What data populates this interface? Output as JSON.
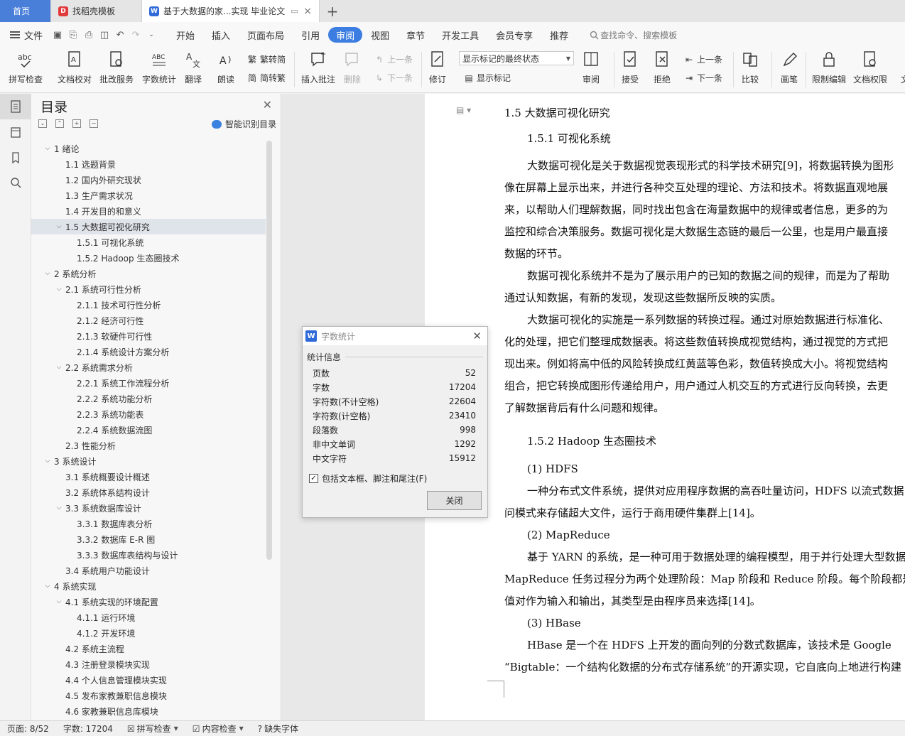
{
  "tabs": [
    {
      "label": "首页"
    },
    {
      "label": "找稻壳模板"
    },
    {
      "label": "基于大数据的家...实现 毕业论文"
    }
  ],
  "menu": {
    "file": "文件",
    "items": [
      "开始",
      "插入",
      "页面布局",
      "引用",
      "审阅",
      "视图",
      "章节",
      "开发工具",
      "会员专享",
      "推荐"
    ],
    "active": "审阅",
    "search": "查找命令、搜索模板"
  },
  "ribbon": {
    "spell": "拼写检查",
    "proof": "文档校对",
    "batch": "批改服务",
    "wordcount": "字数统计",
    "translate": "翻译",
    "read": "朗读",
    "to_trad": "繁转简",
    "to_simp": "简转繁",
    "insert_comment": "插入批注",
    "delete": "删除",
    "prev": "上一条",
    "next": "下一条",
    "revise": "修订",
    "markup_select": "显示标记的最终状态",
    "show_markup": "显示标记",
    "review": "审阅",
    "accept": "接受",
    "reject": "拒绝",
    "prev2": "上一条",
    "next2": "下一条",
    "compare": "比较",
    "pen": "画笔",
    "restrict": "限制编辑",
    "perm": "文档权限",
    "more": "文"
  },
  "toc": {
    "title": "目录",
    "smart": "智能识别目录",
    "items": [
      {
        "label": "1  绪论",
        "level": 0,
        "exp": true
      },
      {
        "label": "1.1  选题背景",
        "level": 1
      },
      {
        "label": "1.2  国内外研究现状",
        "level": 1
      },
      {
        "label": "1.3  生产需求状况",
        "level": 1
      },
      {
        "label": "1.4  开发目的和意义",
        "level": 1
      },
      {
        "label": "1.5  大数据可视化研究",
        "level": 1,
        "exp": true,
        "sel": true
      },
      {
        "label": "1.5.1  可视化系统",
        "level": 2
      },
      {
        "label": "1.5.2 Hadoop 生态圈技术",
        "level": 2
      },
      {
        "label": "2  系统分析",
        "level": 0,
        "exp": true
      },
      {
        "label": "2.1  系统可行性分析",
        "level": 1,
        "exp": true
      },
      {
        "label": "2.1.1  技术可行性分析",
        "level": 2
      },
      {
        "label": "2.1.2  经济可行性",
        "level": 2
      },
      {
        "label": "2.1.3  软硬件可行性",
        "level": 2
      },
      {
        "label": "2.1.4  系统设计方案分析",
        "level": 2
      },
      {
        "label": "2.2  系统需求分析",
        "level": 1,
        "exp": true
      },
      {
        "label": "2.2.1  系统工作流程分析",
        "level": 2
      },
      {
        "label": "2.2.2  系统功能分析",
        "level": 2
      },
      {
        "label": "2.2.3  系统功能表",
        "level": 2
      },
      {
        "label": "2.2.4  系统数据流图",
        "level": 2
      },
      {
        "label": "2.3  性能分析",
        "level": 1
      },
      {
        "label": "3  系统设计",
        "level": 0,
        "exp": true
      },
      {
        "label": "3.1  系统概要设计概述",
        "level": 1
      },
      {
        "label": "3.2  系统体系结构设计",
        "level": 1
      },
      {
        "label": "3.3  系统数据库设计",
        "level": 1,
        "exp": true
      },
      {
        "label": "3.3.1  数据库表分析",
        "level": 2
      },
      {
        "label": "3.3.2  数据库 E-R 图",
        "level": 2
      },
      {
        "label": "3.3.3  数据库表结构与设计",
        "level": 2
      },
      {
        "label": "3.4  系统用户功能设计",
        "level": 1
      },
      {
        "label": "4  系统实现",
        "level": 0,
        "exp": true
      },
      {
        "label": "4.1  系统实现的环境配置",
        "level": 1,
        "exp": true
      },
      {
        "label": "4.1.1  运行环境",
        "level": 2
      },
      {
        "label": "4.1.2  开发环境",
        "level": 2
      },
      {
        "label": "4.2  系统主流程",
        "level": 1
      },
      {
        "label": "4.3  注册登录模块实现",
        "level": 1
      },
      {
        "label": "4.4  个人信息管理模块实现",
        "level": 1
      },
      {
        "label": "4.5  发布家教兼职信息模块",
        "level": 1
      },
      {
        "label": "4.6  家教兼职信息库模块",
        "level": 1
      }
    ]
  },
  "doc": {
    "h1": "1.5  大数据可视化研究",
    "h2a": "1.5.1  可视化系统",
    "p1": [
      "大数据可视化是关于数据视觉表现形式的科学技术研究[9]，将数据转换为图形",
      "像在屏幕上显示出来，并进行各种交互处理的理论、方法和技术。将数据直观地展",
      "来，以帮助人们理解数据，同时找出包含在海量数据中的规律或者信息，更多的为",
      "监控和综合决策服务。数据可视化是大数据生态链的最后一公里，也是用户最直接",
      "数据的环节。"
    ],
    "p2": [
      "数据可视化系统并不是为了展示用户的已知的数据之间的规律，而是为了帮助",
      "通过认知数据，有新的发现，发现这些数据所反映的实质。"
    ],
    "p3": [
      "大数据可视化的实施是一系列数据的转换过程。通过对原始数据进行标准化、",
      "化的处理，把它们整理成数据表。将这些数值转换成视觉结构，通过视觉的方式把",
      "现出来。例如将高中低的风险转换成红黄蓝等色彩，数值转换成大小。将视觉结构",
      "组合，把它转换成图形传递给用户，用户通过人机交互的方式进行反向转换，去更",
      "了解数据背后有什么问题和规律。"
    ],
    "h2b": "1.5.2 Hadoop 生态圈技术",
    "s1": "(1) HDFS",
    "p4": [
      "一种分布式文件系统，提供对应用程序数据的高吞吐量访问，HDFS 以流式数据",
      "问模式来存储超大文件，运行于商用硬件集群上[14]。"
    ],
    "s2": "(2) MapReduce",
    "p5": [
      "基于 YARN 的系统，是一种可用于数据处理的编程模型，用于并行处理大型数据",
      "MapReduce 任务过程分为两个处理阶段：Map 阶段和 Reduce 阶段。每个阶段都是",
      "值对作为输入和输出，其类型是由程序员来选择[14]。"
    ],
    "s3": "(3) HBase",
    "p6": [
      "HBase 是一个在 HDFS 上开发的面向列的分数式数据库，该技术是 Google",
      "“Bigtable：一个结构化数据的分布式存储系统”的开源实现，它自底向上地进行构建"
    ]
  },
  "dialog": {
    "title": "字数统计",
    "group": "统计信息",
    "rows": [
      {
        "k": "页数",
        "v": "52"
      },
      {
        "k": "字数",
        "v": "17204"
      },
      {
        "k": "字符数(不计空格)",
        "v": "22604"
      },
      {
        "k": "字符数(计空格)",
        "v": "23410"
      },
      {
        "k": "段落数",
        "v": "998"
      },
      {
        "k": "非中文单词",
        "v": "1292"
      },
      {
        "k": "中文字符",
        "v": "15912"
      }
    ],
    "include": "包括文本框、脚注和尾注(F)",
    "include_checked": true,
    "close": "关闭"
  },
  "status": {
    "page": "页面: 8/52",
    "words": "字数: 17204",
    "spell": "拼写检查",
    "content": "内容检查",
    "font": "缺失字体"
  },
  "colors": {
    "accent": "#3b7de0",
    "home_tab": "#4a7fd9"
  }
}
